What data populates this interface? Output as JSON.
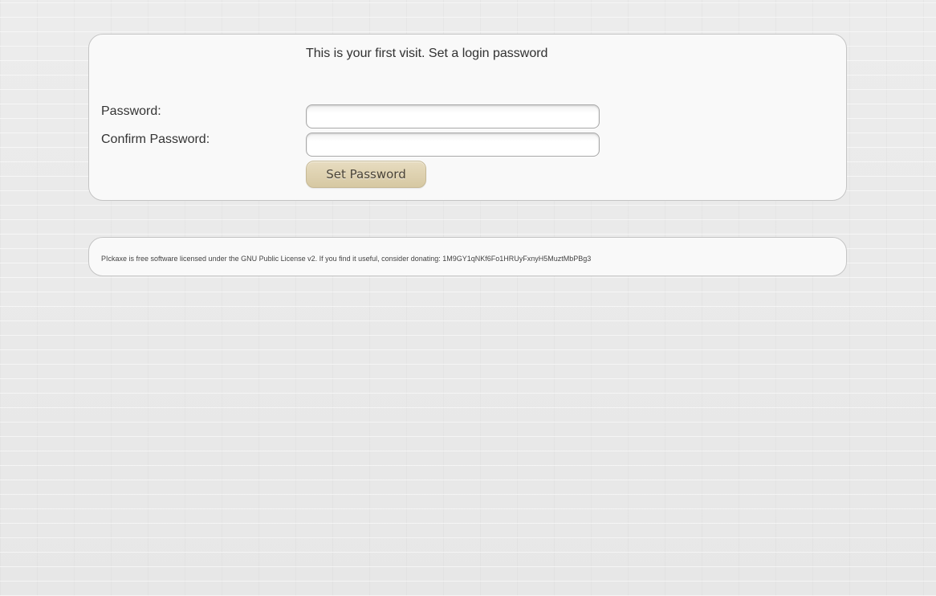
{
  "login": {
    "heading": "This is your first visit. Set a login password",
    "password_label": "Password:",
    "password_value": "",
    "confirm_label": "Confirm Password:",
    "confirm_value": "",
    "submit_label": "Set Password"
  },
  "footer": {
    "text": "PIckaxe is free software licensed under the GNU Public License v2. If you find it useful, consider donating: 1M9GY1qNKf6Fo1HRUyFxnyH5MuztMbPBg3"
  },
  "colors": {
    "button_background": "#ddd0ae",
    "panel_background": "#f9f9f9",
    "page_background": "#e9e9e9"
  }
}
